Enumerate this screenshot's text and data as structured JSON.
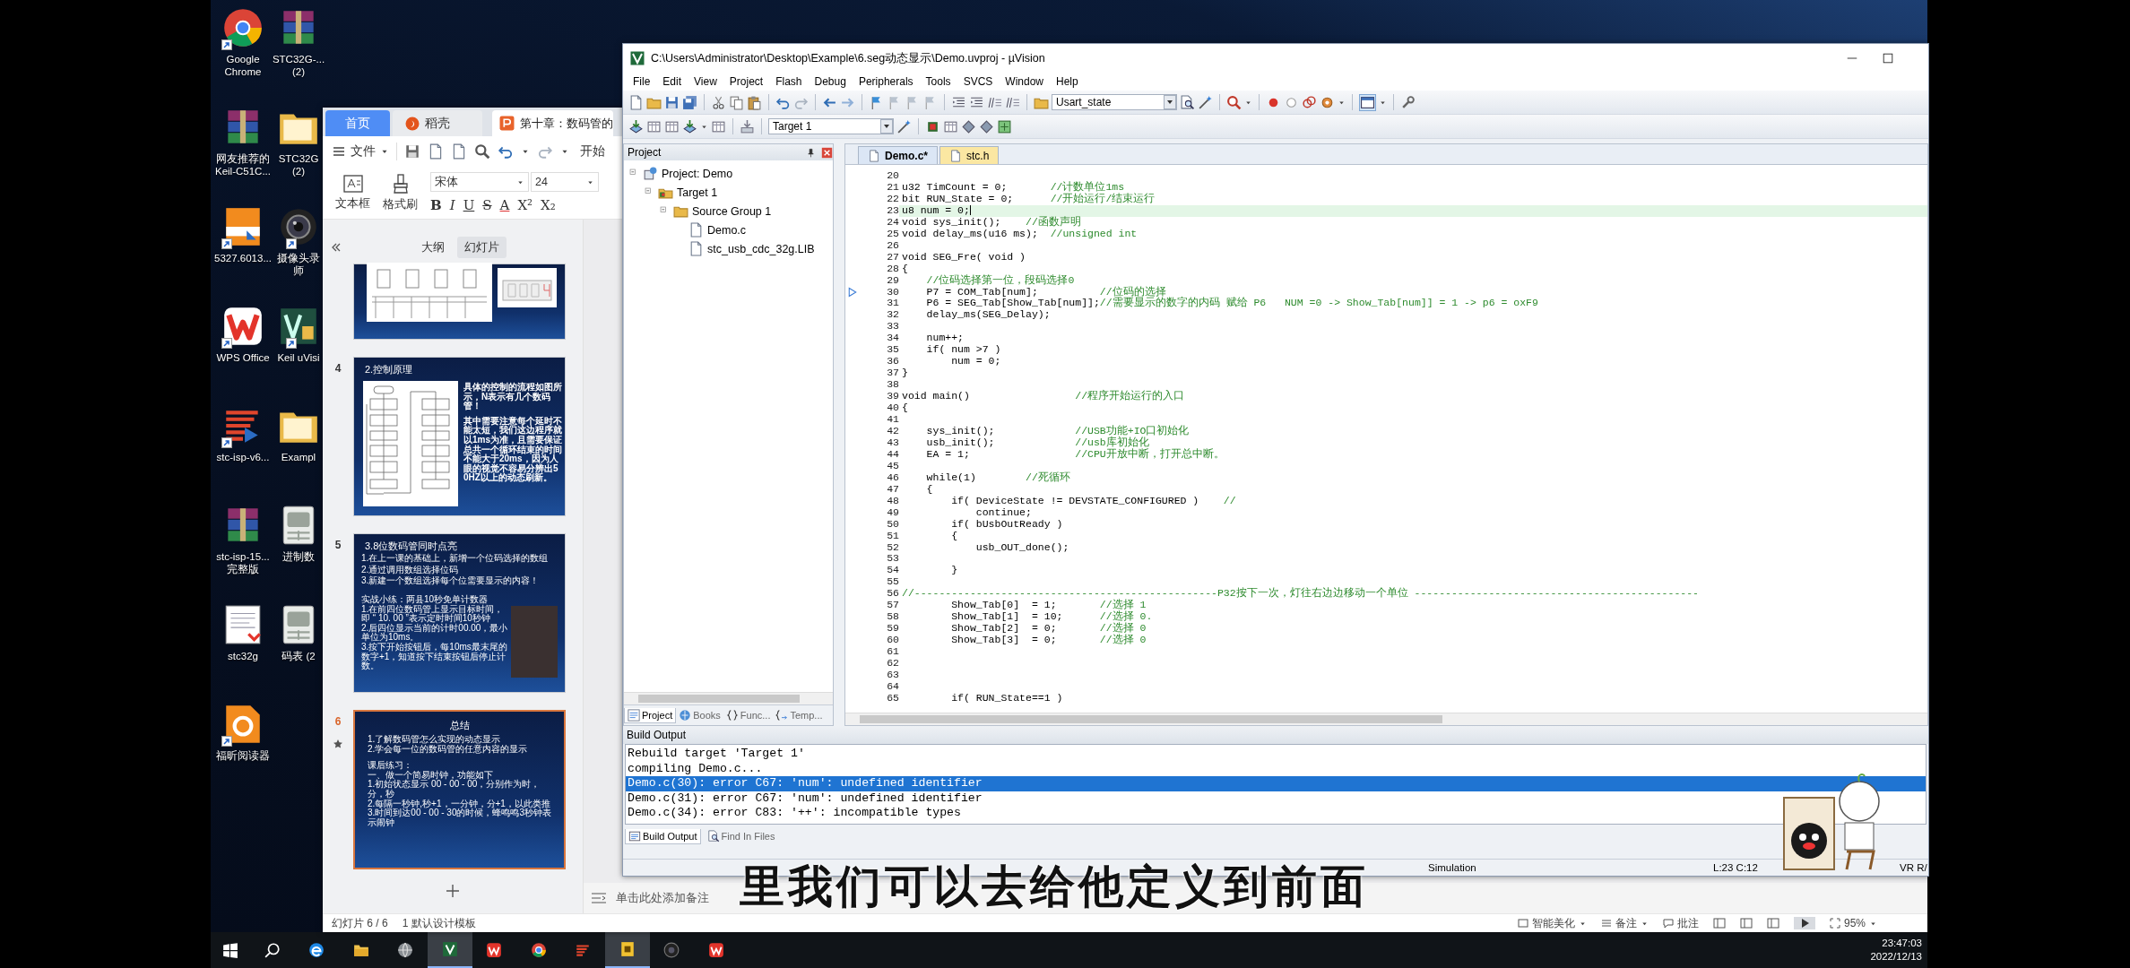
{
  "desktop_icons": [
    {
      "kind": "chrome",
      "shortcut": true,
      "lines": [
        "Google",
        "Chrome"
      ]
    },
    {
      "kind": "archive",
      "shortcut": false,
      "lines": [
        "网友推荐的",
        "Keil-C51C..."
      ]
    },
    {
      "kind": "pdf",
      "shortcut": true,
      "lines": [
        "5327.6013..."
      ]
    },
    {
      "kind": "wps",
      "shortcut": true,
      "lines": [
        "WPS Office"
      ]
    },
    {
      "kind": "isp",
      "shortcut": true,
      "lines": [
        "stc-isp-v6..."
      ]
    },
    {
      "kind": "archive",
      "shortcut": false,
      "lines": [
        "stc-isp-15...",
        "完整版"
      ]
    },
    {
      "kind": "document",
      "shortcut": false,
      "lines": [
        "stc32g"
      ]
    },
    {
      "kind": "foxit",
      "shortcut": true,
      "lines": [
        "福昕阅读器"
      ]
    },
    {
      "kind": "archive",
      "shortcut": false,
      "lines": [
        "STC32G-...",
        "(2)"
      ]
    },
    {
      "kind": "folder",
      "shortcut": false,
      "lines": [
        "STC32G",
        "(2)"
      ]
    },
    {
      "kind": "camera",
      "shortcut": true,
      "lines": [
        "摄像头录",
        "师"
      ]
    },
    {
      "kind": "keil",
      "shortcut": true,
      "lines": [
        "Keil uVisi"
      ]
    },
    {
      "kind": "folder",
      "shortcut": false,
      "lines": [
        "Exampl"
      ]
    },
    {
      "kind": "sheet",
      "shortcut": false,
      "lines": [
        "进制数"
      ]
    },
    {
      "kind": "sheet",
      "shortcut": false,
      "lines": [
        "码表 (2"
      ]
    }
  ],
  "wps": {
    "tabs": [
      {
        "kind": "home",
        "label": "首页",
        "selected": false
      },
      {
        "kind": "docer",
        "label": "稻壳",
        "selected": false
      },
      {
        "kind": "document",
        "label": "第十章：数码管的",
        "selected": true
      }
    ],
    "menu": {
      "file": "文件",
      "start": "开始"
    },
    "ribbon": {
      "textbox": "文本框",
      "painter": "格式刷",
      "font": "宋体",
      "size": "24",
      "format_buttons": [
        "B",
        "I",
        "U",
        "S",
        "A",
        "X²",
        "X₂"
      ]
    },
    "panel_tabs": [
      {
        "label": "大纲",
        "selected": false
      },
      {
        "label": "幻灯片",
        "selected": true
      }
    ],
    "slides": [
      {
        "kind": "partial",
        "selected": false,
        "animated": false
      },
      {
        "kind": "diagram",
        "number": "4",
        "selected": false,
        "animated": false,
        "title": "2.控制原理",
        "paragraphs": [
          "具体的控制的流程如图所示，N表示有几个数码管！",
          "其中需要注意每个延时不能太短，我们这边程序就以1ms为准，且需要保证总共一个循环结束的时间不能大于20ms，因为人眼的视觉不容易分辨出50HZ以上的动态刷新。"
        ]
      },
      {
        "kind": "photo",
        "number": "5",
        "selected": false,
        "animated": false,
        "title": "3.8位数码管同时点亮",
        "paragraphs": [
          "1.在上一课的基础上，新增一个位码选择的数组",
          "2.通过调用数组选择位码",
          "3.新建一个数组选择每个位需要显示的内容！"
        ],
        "exercise": [
          "实战小练：两县10秒免单计数器",
          "1.在前四位数码管上显示目标时间，即 “ 10. 00 ”表示定时时间10秒钟",
          "2.后四位显示当前的计时00.00，最小单位为10ms。",
          "3.按下开始按钮后，每10ms最末尾的数字+1，知道按下结束按钮后停止计数。"
        ]
      },
      {
        "kind": "summary",
        "number": "6",
        "selected": true,
        "animated": true,
        "title": "总结",
        "paragraphs": [
          "1.了解数码管怎么实现的动态显示",
          "2.学会每一位的数码管的任意内容的显示"
        ],
        "exercise": [
          "课后练习：",
          "一、做一个简易时钟，功能如下",
          "1.初始状态显示 00 - 00 - 00，分别作为时，分，秒",
          "2.每隔一秒钟,秒+1，一分钟，分+1，以此类推",
          "3.时间到达00 - 00 - 30的时候，蜂鸣鸣3秒钟表示闹钟"
        ]
      }
    ],
    "notes_placeholder": "单击此处添加备注",
    "status": {
      "slide": "幻灯片 6 / 6",
      "template": "1 默认设计模板",
      "beautify": "智能美化",
      "notes": "备注",
      "comments": "批注",
      "zoom": "95%"
    }
  },
  "keil": {
    "title": "C:\\Users\\Administrator\\Desktop\\Example\\6.seg动态显示\\Demo.uvproj - µVision",
    "menu": [
      "File",
      "Edit",
      "View",
      "Project",
      "Flash",
      "Debug",
      "Peripherals",
      "Tools",
      "SVCS",
      "Window",
      "Help"
    ],
    "find_combo": "Usart_state",
    "target_combo": "Target 1",
    "project": {
      "title": "Project",
      "tree": [
        {
          "kind": "project",
          "label": "Project: Demo",
          "expanded": true,
          "children": [
            {
              "kind": "target",
              "label": "Target 1",
              "expanded": true,
              "children": [
                {
                  "kind": "group",
                  "label": "Source Group 1",
                  "expanded": true,
                  "children": [
                    {
                      "kind": "file",
                      "label": "Demo.c"
                    },
                    {
                      "kind": "file",
                      "label": "stc_usb_cdc_32g.LIB"
                    }
                  ]
                }
              ]
            }
          ]
        }
      ],
      "tabs": [
        {
          "kind": "project",
          "label": "Project",
          "selected": true
        },
        {
          "kind": "books",
          "label": "Books",
          "selected": false
        },
        {
          "kind": "functions",
          "label": "Func...",
          "selected": false
        },
        {
          "kind": "templates",
          "label": "Temp...",
          "selected": false
        }
      ]
    },
    "editor": {
      "tabs": [
        {
          "label": "Demo.c*",
          "kind": "source",
          "selected": true
        },
        {
          "label": "stc.h",
          "kind": "header",
          "selected": false
        }
      ],
      "lines": [
        {
          "number": "20",
          "current": false,
          "marked": false
        },
        {
          "number": "21",
          "code": "u32 TimCount = 0;       ",
          "comment": "//计数单位1ms",
          "current": false,
          "marked": false
        },
        {
          "number": "22",
          "code": "bit RUN_State = 0;      ",
          "comment": "//开始运行/结束运行",
          "current": false,
          "marked": false
        },
        {
          "number": "23",
          "code": "u8 num = 0;",
          "current": true,
          "marked": false
        },
        {
          "number": "24",
          "code": "void sys_init();    ",
          "comment": "//函数声明",
          "current": false,
          "marked": false
        },
        {
          "number": "25",
          "code": "void delay_ms(u16 ms);  ",
          "comment": "//unsigned int",
          "current": false,
          "marked": false
        },
        {
          "number": "26",
          "current": false,
          "marked": false
        },
        {
          "number": "27",
          "code": "void SEG_Fre( void )",
          "current": false,
          "marked": false
        },
        {
          "number": "28",
          "code": "{",
          "current": false,
          "marked": false
        },
        {
          "number": "29",
          "comment": "    //位码选择第一位，段码选择0",
          "current": false,
          "marked": false
        },
        {
          "number": "30",
          "code": "    P7 = COM_Tab[num];          ",
          "comment": "//位码的选择",
          "current": false,
          "marked": true
        },
        {
          "number": "31",
          "code": "    P6 = SEG_Tab[Show_Tab[num]];",
          "comment": "//需要显示的数字的内码 赋给 P6   NUM =0 -> Show_Tab[num]] = 1 -> p6 = oxF9",
          "current": false,
          "marked": false
        },
        {
          "number": "32",
          "code": "    delay_ms(SEG_Delay);",
          "current": false,
          "marked": false
        },
        {
          "number": "33",
          "current": false,
          "marked": false
        },
        {
          "number": "34",
          "code": "    num++;",
          "current": false,
          "marked": false
        },
        {
          "number": "35",
          "code": "    if( num >7 )",
          "current": false,
          "marked": false
        },
        {
          "number": "36",
          "code": "        num = 0;",
          "current": false,
          "marked": false
        },
        {
          "number": "37",
          "code": "}",
          "current": false,
          "marked": false
        },
        {
          "number": "38",
          "current": false,
          "marked": false
        },
        {
          "number": "39",
          "code": "void main()                 ",
          "comment": "//程序开始运行的入口",
          "current": false,
          "marked": false
        },
        {
          "number": "40",
          "code": "{",
          "current": false,
          "marked": false
        },
        {
          "number": "41",
          "current": false,
          "marked": false
        },
        {
          "number": "42",
          "code": "    sys_init();             ",
          "comment": "//USB功能+IO口初始化",
          "current": false,
          "marked": false
        },
        {
          "number": "43",
          "code": "    usb_init();             ",
          "comment": "//usb库初始化",
          "current": false,
          "marked": false
        },
        {
          "number": "44",
          "code": "    EA = 1;                 ",
          "comment": "//CPU开放中断，打开总中断。",
          "current": false,
          "marked": false
        },
        {
          "number": "45",
          "current": false,
          "marked": false
        },
        {
          "number": "46",
          "code": "    while(1)        ",
          "comment": "//死循环",
          "current": false,
          "marked": false
        },
        {
          "number": "47",
          "code": "    {",
          "current": false,
          "marked": false
        },
        {
          "number": "48",
          "code": "        if( DeviceState != DEVSTATE_CONFIGURED )    ",
          "comment": "//",
          "current": false,
          "marked": false
        },
        {
          "number": "49",
          "code": "            continue;",
          "current": false,
          "marked": false
        },
        {
          "number": "50",
          "code": "        if( bUsbOutReady )",
          "current": false,
          "marked": false
        },
        {
          "number": "51",
          "code": "        {",
          "current": false,
          "marked": false
        },
        {
          "number": "52",
          "code": "            usb_OUT_done();",
          "current": false,
          "marked": false
        },
        {
          "number": "53",
          "current": false,
          "marked": false
        },
        {
          "number": "54",
          "code": "        }",
          "current": false,
          "marked": false
        },
        {
          "number": "55",
          "current": false,
          "marked": false
        },
        {
          "number": "56",
          "comment": "//-------------------------------------------------P32按下一次，灯往右边边移动一个单位 ----------------------------------------------",
          "current": false,
          "marked": false
        },
        {
          "number": "57",
          "code": "        Show_Tab[0]  = 1;       ",
          "comment": "//选择 1",
          "current": false,
          "marked": false
        },
        {
          "number": "58",
          "code": "        Show_Tab[1]  = 10;      ",
          "comment": "//选择 0.",
          "current": false,
          "marked": false
        },
        {
          "number": "59",
          "code": "        Show_Tab[2]  = 0;       ",
          "comment": "//选择 0",
          "current": false,
          "marked": false
        },
        {
          "number": "60",
          "code": "        Show_Tab[3]  = 0;       ",
          "comment": "//选择 0",
          "current": false,
          "marked": false
        },
        {
          "number": "61",
          "current": false,
          "marked": false
        },
        {
          "number": "62",
          "current": false,
          "marked": false
        },
        {
          "number": "63",
          "current": false,
          "marked": false
        },
        {
          "number": "64",
          "current": false,
          "marked": false
        },
        {
          "number": "65",
          "code": "        if( RUN_State==1 )",
          "current": false,
          "marked": false
        }
      ]
    },
    "build_output": {
      "title": "Build Output",
      "lines": [
        {
          "text": "Rebuild target 'Target 1'",
          "selected": false
        },
        {
          "text": "compiling Demo.c...",
          "selected": false
        },
        {
          "text": "Demo.c(30): error C67: 'num': undefined identifier",
          "selected": true
        },
        {
          "text": "Demo.c(31): error C67: 'num': undefined identifier",
          "selected": false
        },
        {
          "text": "Demo.c(34): error C83: '++': incompatible types",
          "selected": false
        }
      ],
      "tabs": [
        {
          "kind": "output",
          "label": "Build Output",
          "selected": true
        },
        {
          "kind": "find",
          "label": "Find In Files",
          "selected": false
        }
      ]
    },
    "status_bar": [
      "Simulation",
      "L:23 C:12",
      "VR R/"
    ]
  },
  "subtitle": "里我们可以去给他定义到前面",
  "taskbar": {
    "buttons": [
      {
        "kind": "start",
        "active": false
      },
      {
        "kind": "search",
        "active": false
      },
      {
        "kind": "edge",
        "active": false
      },
      {
        "kind": "folder",
        "active": false
      },
      {
        "kind": "globe",
        "active": false
      },
      {
        "kind": "keil",
        "active": true
      },
      {
        "kind": "wps",
        "active": false
      },
      {
        "kind": "chrome",
        "active": false
      },
      {
        "kind": "isp",
        "active": false
      },
      {
        "kind": "recorder",
        "active": true
      },
      {
        "kind": "camera",
        "active": false
      },
      {
        "kind": "wps",
        "active": false
      }
    ],
    "time": "23:47:03",
    "date": "2022/12/13"
  }
}
